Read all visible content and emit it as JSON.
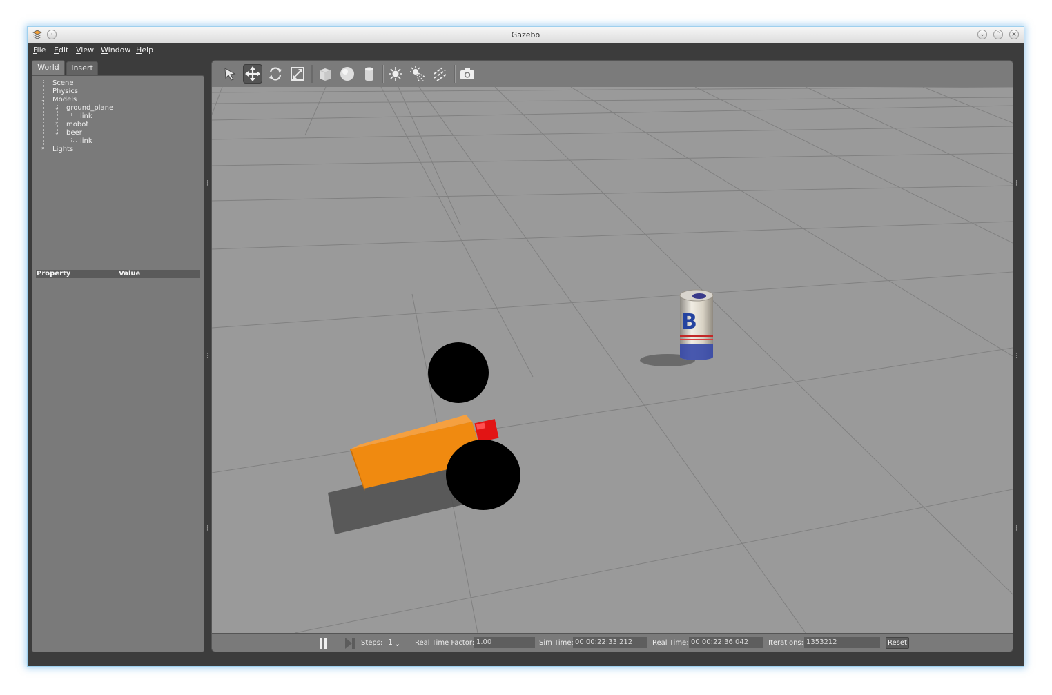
{
  "window": {
    "title": "Gazebo"
  },
  "menu": [
    {
      "key": "F",
      "rest": "ile"
    },
    {
      "key": "E",
      "rest": "dit"
    },
    {
      "key": "V",
      "rest": "iew"
    },
    {
      "key": "W",
      "rest": "indow"
    },
    {
      "key": "H",
      "rest": "elp"
    }
  ],
  "left_panel": {
    "tabs": [
      "World",
      "Insert"
    ],
    "active_tab": "World",
    "tree": {
      "scene": "Scene",
      "physics": "Physics",
      "models": "Models",
      "ground_plane": "ground_plane",
      "ground_plane_link": "link",
      "mobot": "mobot",
      "beer": "beer",
      "beer_link": "link",
      "lights": "Lights"
    },
    "property_table": {
      "col_property": "Property",
      "col_value": "Value"
    }
  },
  "toolbar": {
    "tools": [
      "select-arrow-icon",
      "translate-icon",
      "rotate-icon",
      "scale-icon",
      "box-icon",
      "sphere-icon",
      "cylinder-icon",
      "point-light-icon",
      "spot-light-icon",
      "directional-light-icon",
      "screenshot-camera-icon"
    ],
    "active_tool": "translate-icon"
  },
  "scene_labels": {
    "beer_can_letter": "B"
  },
  "bottom_bar": {
    "steps_label": "Steps:",
    "steps_value": "1",
    "rtf_label": "Real Time Factor:",
    "rtf_value": "1.00",
    "sim_time_label": "Sim Time:",
    "sim_time_value": "00 00:22:33.212",
    "real_time_label": "Real Time:",
    "real_time_value": "00 00:22:36.042",
    "iterations_label": "Iterations:",
    "iterations_value": "1353212",
    "reset_label": "Reset"
  },
  "colors": {
    "robot_body": "#f08a10",
    "robot_wheels": "#000000",
    "robot_marker": "#e01010",
    "ground": "#9a9a9a",
    "grid_lines": "#7f7f7f",
    "window_chrome": "#3c3c3c",
    "panel": "#7a7a7a"
  }
}
